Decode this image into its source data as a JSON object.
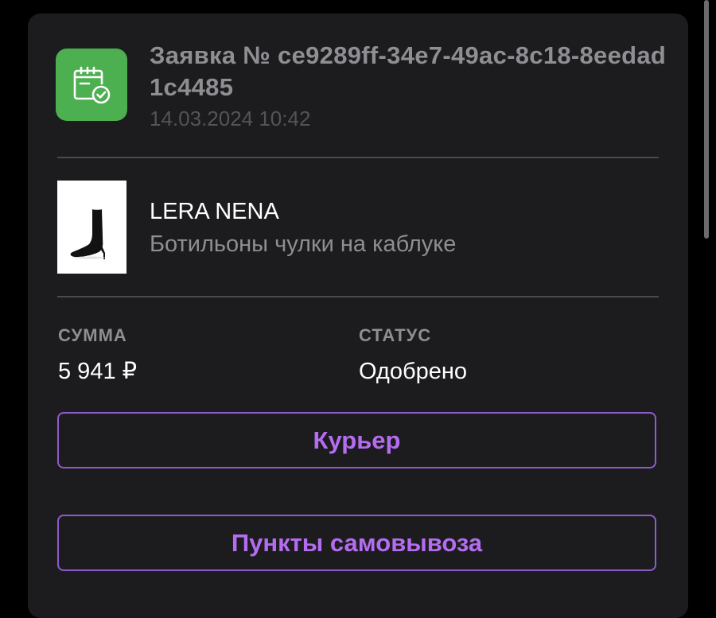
{
  "order": {
    "title": "Заявка № ce9289ff-34e7-49ac-8c18-8eedad1c4485",
    "datetime": "14.03.2024 10:42",
    "icon": "calendar-check-icon",
    "icon_color": "#4caf50"
  },
  "product": {
    "brand": "LERA NENA",
    "name": "Ботильоны чулки на каблуке",
    "image": "boot-image"
  },
  "summary": {
    "amount_label": "СУММА",
    "amount_value": "5 941 ₽",
    "status_label": "СТАТУС",
    "status_value": "Одобрено"
  },
  "actions": {
    "courier_label": "Курьер",
    "pickup_label": "Пункты самовывоза",
    "accent_color": "#b46cf0"
  }
}
